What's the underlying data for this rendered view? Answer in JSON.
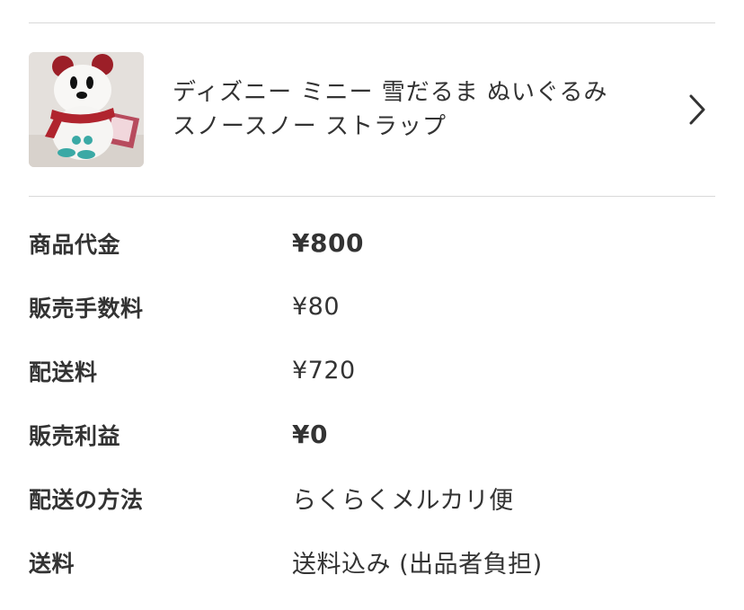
{
  "item": {
    "title": "ディズニー ミニー 雪だるま ぬいぐるみ\nスノースノー ストラップ",
    "thumbnail_icon": "minnie-snowman-plush-image",
    "chevron_icon": "chevron-right-icon"
  },
  "summary": {
    "rows": [
      {
        "label": "商品代金",
        "value": "¥800"
      },
      {
        "label": "販売手数料",
        "value": "¥80"
      },
      {
        "label": "配送料",
        "value": "¥720"
      },
      {
        "label": "販売利益",
        "value": "¥0"
      },
      {
        "label": "配送の方法",
        "value": "らくらくメルカリ便"
      },
      {
        "label": "送料",
        "value": "送料込み (出品者負担)"
      }
    ]
  }
}
